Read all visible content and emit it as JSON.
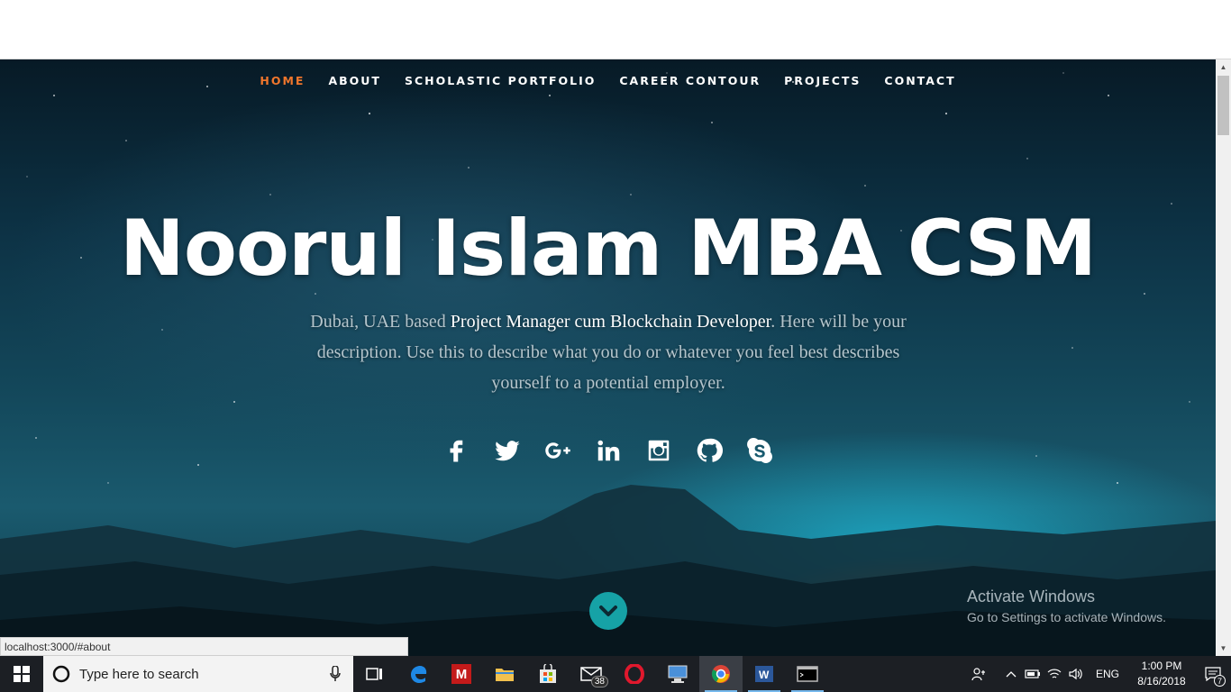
{
  "nav": {
    "items": [
      {
        "label": "HOME",
        "active": true
      },
      {
        "label": "ABOUT",
        "active": false
      },
      {
        "label": "SCHOLASTIC PORTFOLIO",
        "active": false
      },
      {
        "label": "CAREER CONTOUR",
        "active": false
      },
      {
        "label": "PROJECTS",
        "active": false
      },
      {
        "label": "CONTACT",
        "active": false
      }
    ],
    "active_color": "#f0762c"
  },
  "hero": {
    "title": "Noorul Islam MBA CSM",
    "desc_pre": "Dubai, UAE based ",
    "desc_strong": "Project Manager cum Blockchain Developer",
    "desc_post": ". Here will be your description. Use this to describe what you do or whatever you feel best describes yourself to a potential employer.",
    "social_icons": [
      "facebook-icon",
      "twitter-icon",
      "google-plus-icon",
      "linkedin-icon",
      "instagram-icon",
      "github-icon",
      "skype-icon"
    ],
    "scroll_button_color": "#16a2a6"
  },
  "watermark": {
    "line1": "Activate Windows",
    "line2": "Go to Settings to activate Windows."
  },
  "status_bar": {
    "url": "localhost:3000/#about"
  },
  "taskbar": {
    "search_placeholder": "Type here to search",
    "mail_badge": "38",
    "language": "ENG",
    "time": "1:00 PM",
    "date": "8/16/2018",
    "notification_count": "7"
  }
}
